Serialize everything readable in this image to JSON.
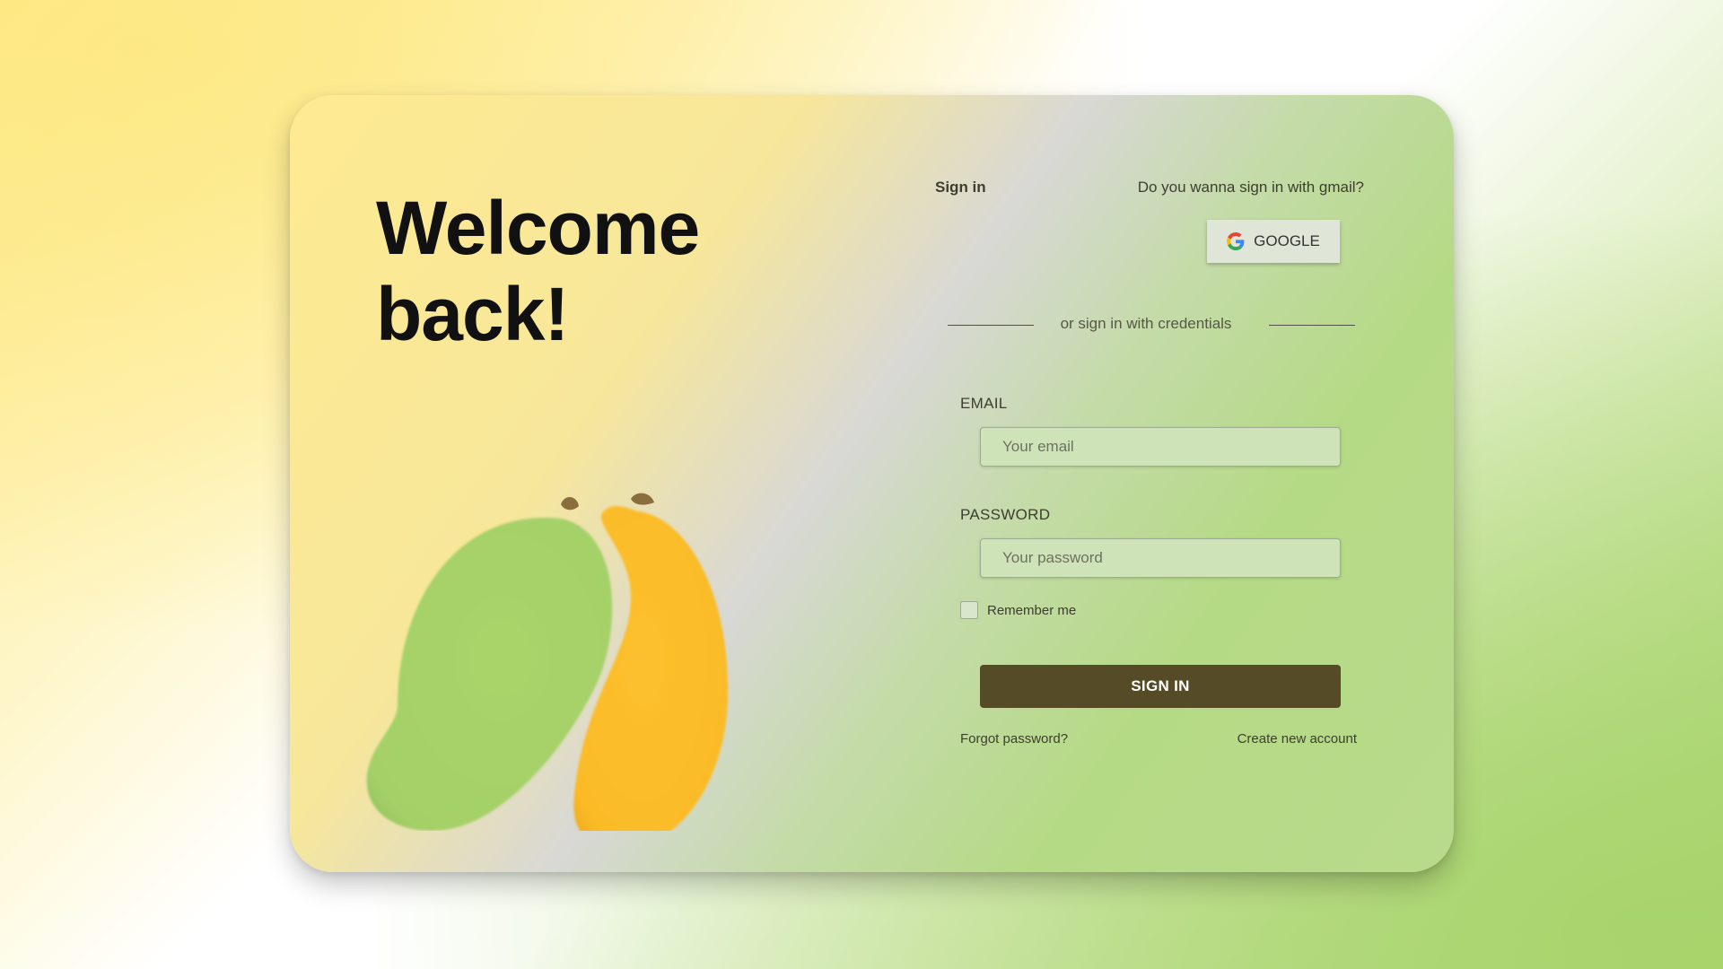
{
  "welcome": {
    "line1": "Welcome",
    "line2": "back!"
  },
  "signin": {
    "title": "Sign in",
    "gmail_question": "Do you wanna sign in with gmail?",
    "google_button": "GOOGLE",
    "divider_text": "or sign in with credentials"
  },
  "form": {
    "email_label": "EMAIL",
    "email_placeholder": "Your email",
    "password_label": "PASSWORD",
    "password_placeholder": "Your password",
    "remember_label": "Remember me",
    "remember_checked": false,
    "submit_label": "SIGN IN"
  },
  "links": {
    "forgot": "Forgot password?",
    "create": "Create new account"
  },
  "colors": {
    "accent": "#554b27",
    "mango_green": "#a8d46c",
    "mango_yellow": "#fbbd2b",
    "background_yellow": "#fdea8c",
    "background_green": "#a8d46c"
  },
  "icons": {
    "google": "google-icon",
    "illustration": "mango-illustration"
  }
}
